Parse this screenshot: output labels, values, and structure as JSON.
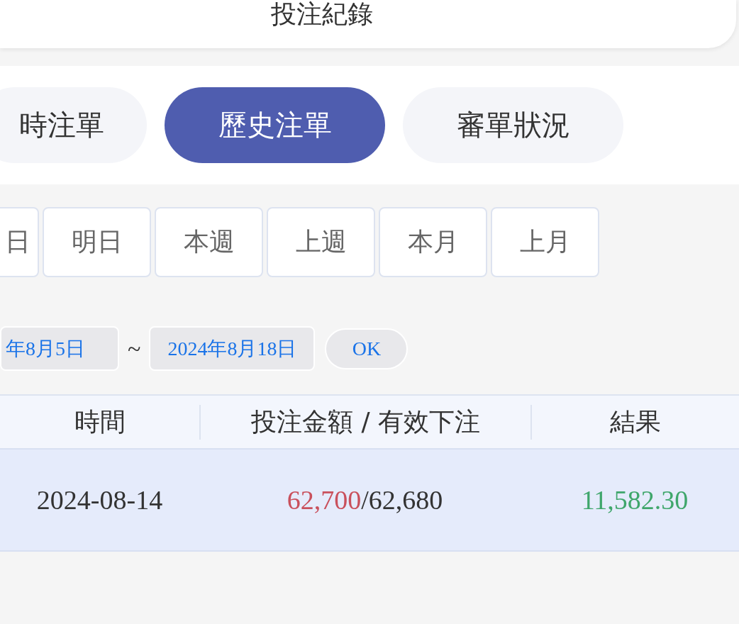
{
  "header": {
    "title": "投注紀錄"
  },
  "tabs": [
    {
      "label": "時注單",
      "selected": false
    },
    {
      "label": "歷史注單",
      "selected": true
    },
    {
      "label": "審單狀況",
      "selected": false
    }
  ],
  "quick_ranges": [
    {
      "label": "日"
    },
    {
      "label": "明日"
    },
    {
      "label": "本週"
    },
    {
      "label": "上週"
    },
    {
      "label": "本月"
    },
    {
      "label": "上月"
    }
  ],
  "date_range": {
    "start": "年8月5日",
    "separator": "~",
    "end": "2024年8月18日",
    "confirm": "OK"
  },
  "table": {
    "columns": [
      "時間",
      "投注金額 / 有效下注",
      "結果"
    ],
    "rows": [
      {
        "time": "2024-08-14",
        "wager": "62,700",
        "separator": "/",
        "effective": "62,680",
        "result": "11,582.30"
      }
    ]
  }
}
